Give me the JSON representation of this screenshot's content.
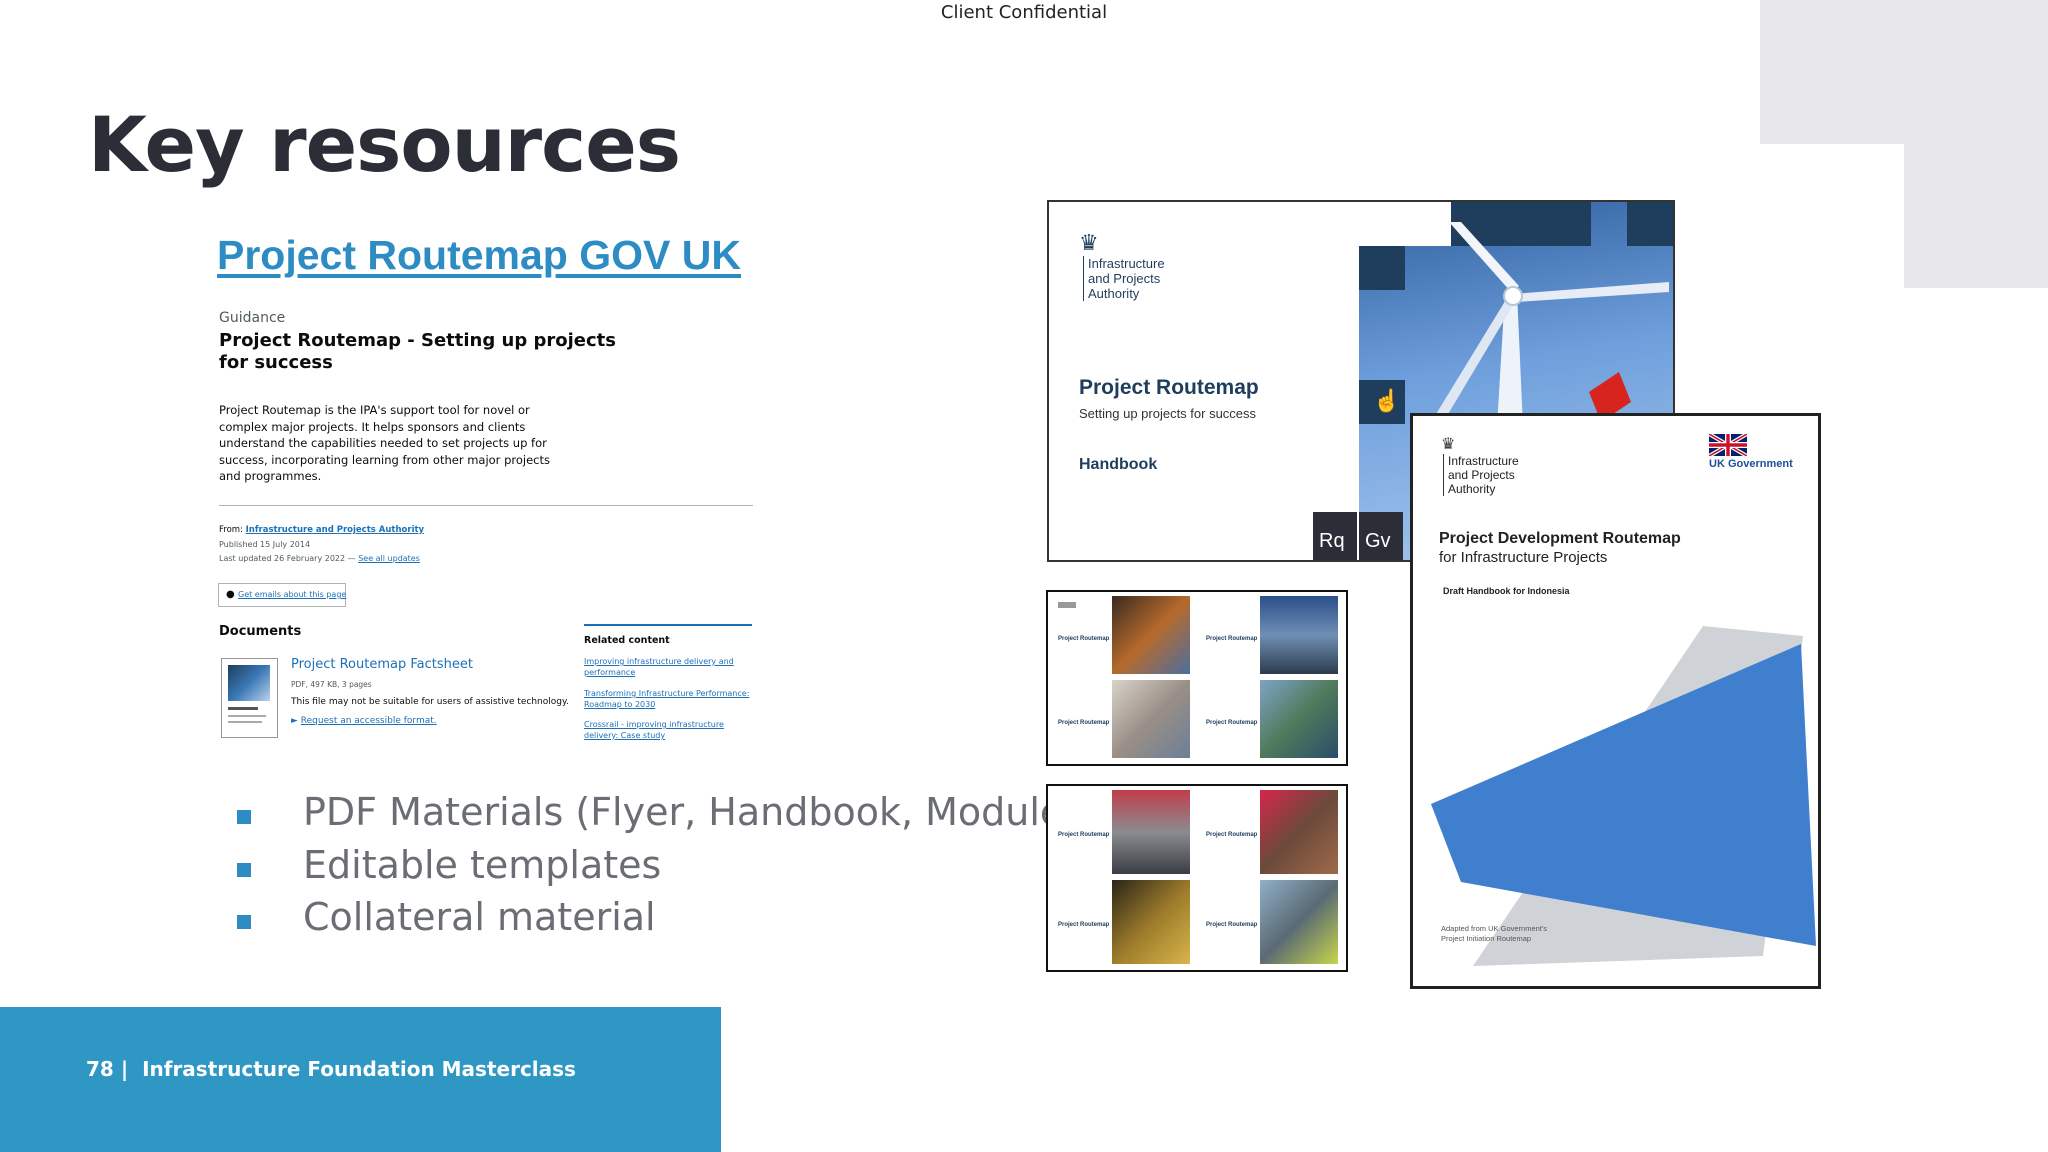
{
  "header": {
    "confidential": "Client Confidential"
  },
  "title": "Key resources",
  "link": {
    "label": "Project Routemap GOV UK"
  },
  "govuk": {
    "eyebrow": "Guidance",
    "heading_line1": "Project Routemap - Setting up projects",
    "heading_line2": "for success",
    "description": [
      "Project Routemap is the IPA's support tool for novel or",
      "complex major projects. It helps sponsors and clients",
      "understand the capabilities needed to set projects up for",
      "success, incorporating learning from other major projects",
      "and programmes."
    ],
    "from_prefix": "From:",
    "from_org": "Infrastructure and Projects Authority",
    "published": "Published 15 July 2014",
    "last_updated": "Last updated 26 February 2022 —",
    "see_updates": "See all updates",
    "email_button": "Get emails about this page",
    "documents_heading": "Documents",
    "doc_title": "Project Routemap Factsheet",
    "doc_meta": "PDF, 497 KB, 3 pages",
    "doc_note": "This file may not be suitable for users of assistive technology.",
    "doc_request": "Request an accessible format.",
    "related_heading": "Related content",
    "related": [
      [
        "Improving infrastructure delivery and",
        "performance"
      ],
      [
        "Transforming Infrastructure Performance:",
        "Roadmap to 2030"
      ],
      [
        "Crossrail - improving infrastructure",
        "delivery: Case study"
      ]
    ]
  },
  "bullets": [
    "PDF Materials (Flyer, Handbook, Modules)",
    "Editable templates",
    "Collateral material"
  ],
  "footer": {
    "page": "78",
    "separator": "|",
    "label": "Infrastructure Foundation Masterclass"
  },
  "handbook": {
    "org": [
      "Infrastructure",
      "and Projects",
      "Authority"
    ],
    "title": "Project Routemap",
    "subtitle": "Setting up projects for success",
    "label": "Handbook",
    "codes": [
      "Rq",
      "Gv"
    ]
  },
  "thumbnails": {
    "tile_title": "Project Routemap"
  },
  "draft": {
    "org": [
      "Infrastructure",
      "and Projects",
      "Authority"
    ],
    "gov_label": "UK Government",
    "title": "Project Development Routemap",
    "subtitle": "for Infrastructure Projects",
    "draft_label": "Draft Handbook for Indonesia",
    "adapted": [
      "Adapted from UK Government's",
      "Project Initiation Routemap"
    ]
  },
  "colors": {
    "accent": "#2d8cc4",
    "title": "#2b2e36",
    "navy": "#1f3d5c",
    "draft_blue": "#3f7fce"
  }
}
